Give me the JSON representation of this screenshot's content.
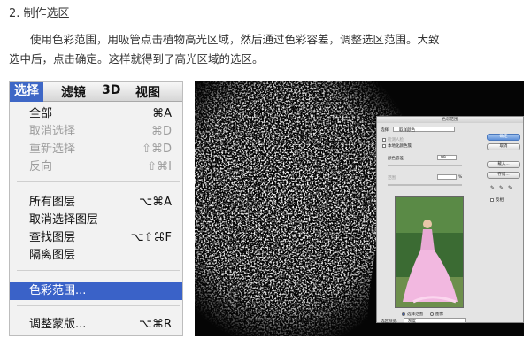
{
  "heading": "2.  制作选区",
  "paragraph": {
    "line1": "使用色彩范围，用吸管点击植物高光区域，然后通过色彩容差，调整选区范围。大致",
    "line2": "选中后，点击确定。这样就得到了高光区域的选区。"
  },
  "menubar": {
    "items": [
      "选择",
      "滤镜",
      "3D",
      "视图"
    ]
  },
  "menu": {
    "items": [
      {
        "label": "全部",
        "shortcut": "⌘A",
        "disabled": false
      },
      {
        "label": "取消选择",
        "shortcut": "⌘D",
        "disabled": true
      },
      {
        "label": "重新选择",
        "shortcut": "⇧⌘D",
        "disabled": true
      },
      {
        "label": "反向",
        "shortcut": "⇧⌘I",
        "disabled": true
      },
      {
        "label": "所有图层",
        "shortcut": "⌥⌘A",
        "disabled": false
      },
      {
        "label": "取消选择图层",
        "shortcut": "",
        "disabled": false
      },
      {
        "label": "查找图层",
        "shortcut": "⌥⇧⌘F",
        "disabled": false
      },
      {
        "label": "隔离图层",
        "shortcut": "",
        "disabled": false
      },
      {
        "label": "色彩范围...",
        "shortcut": "",
        "disabled": false
      },
      {
        "label": "调整蒙版...",
        "shortcut": "⌥⌘R",
        "disabled": false
      }
    ]
  },
  "dialog": {
    "title": "色彩范围",
    "select_label": "选择:",
    "select_value": "取样颜色",
    "detect_faces": "检测人脸",
    "localized": "本地化颜色簇",
    "fuzziness_label": "颜色容差:",
    "fuzziness_value": "99",
    "range_label": "范围:",
    "range_unit": "%",
    "ok": "确定",
    "cancel": "取消",
    "load": "载入...",
    "save": "存储...",
    "invert": "反相",
    "radio_selection": "选择范围",
    "radio_image": "图像",
    "preview_label": "选区预览:",
    "preview_value": "灰度"
  },
  "colors": {
    "menu_highlight": "#3a62c8",
    "photo_bg": "#050505",
    "dialog_bg": "#e4e4e4"
  }
}
